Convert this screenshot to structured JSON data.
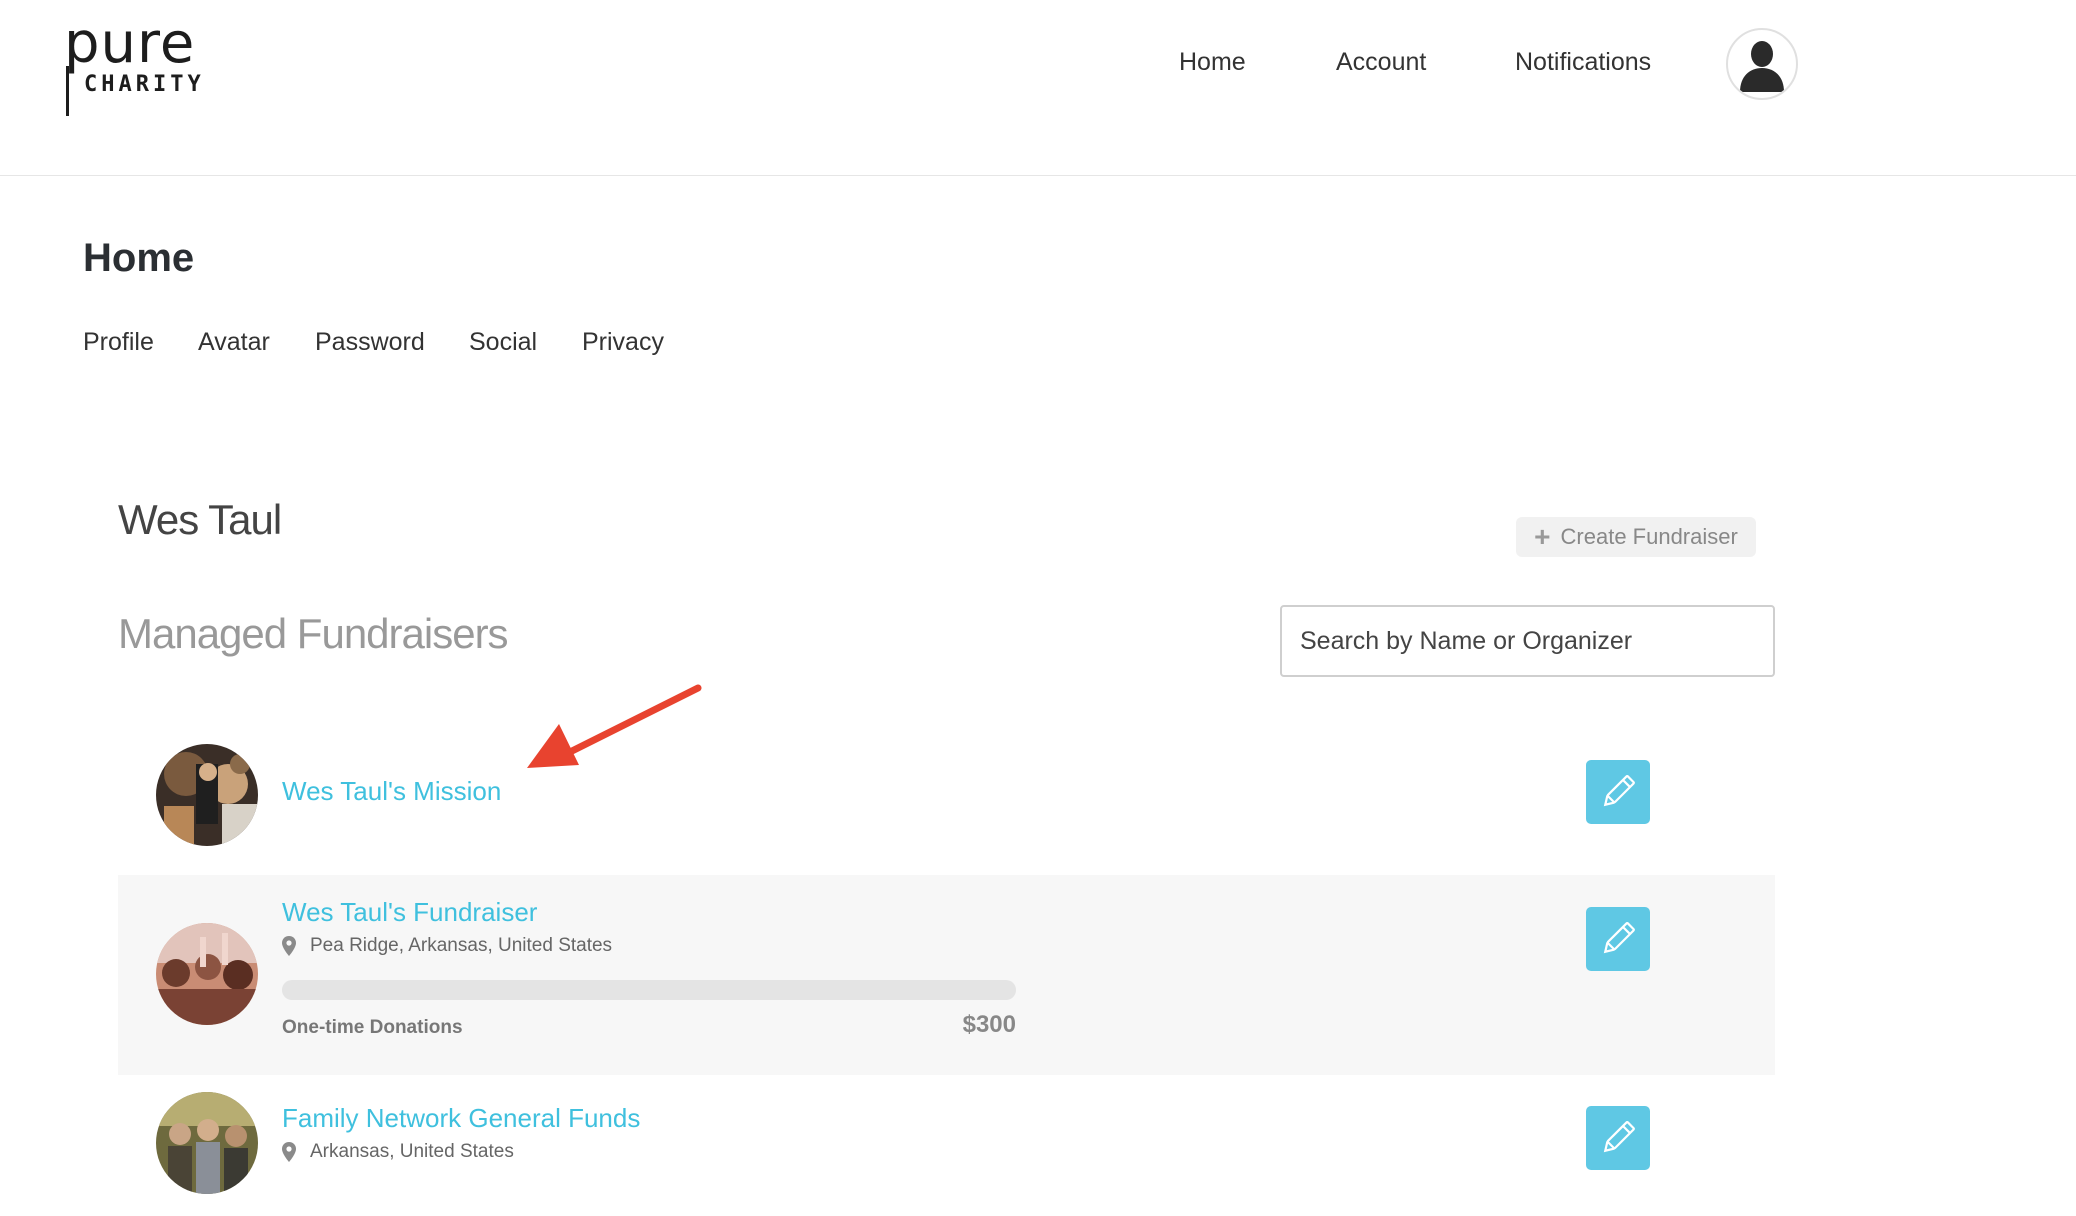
{
  "header": {
    "logo_top": "pure",
    "logo_bottom": "CHARITY",
    "nav": {
      "home": "Home",
      "account": "Account",
      "notifications": "Notifications"
    },
    "user_icon": "user-silhouette-icon"
  },
  "page": {
    "title": "Home",
    "subnav": {
      "profile": "Profile",
      "avatar": "Avatar",
      "password": "Password",
      "social": "Social",
      "privacy": "Privacy"
    }
  },
  "content": {
    "user_name": "Wes Taul",
    "create_button": {
      "icon": "plus-icon",
      "label": "Create Fundraiser"
    },
    "section_title": "Managed Fundraisers",
    "search": {
      "placeholder": "Search by Name or Organizer",
      "value": ""
    },
    "fundraisers": [
      {
        "title": "Wes Taul's Mission"
      },
      {
        "title": "Wes Taul's Fundraiser",
        "location": "Pea Ridge, Arkansas, United States",
        "progress_fraction": 0,
        "donation_label": "One-time Donations",
        "donation_amount": "$300"
      },
      {
        "title": "Family Network General Funds",
        "location": "Arkansas, United States"
      }
    ]
  },
  "colors": {
    "link": "#3fc0de",
    "edit_button": "#5fc8e4",
    "annotation_arrow": "#e8432f"
  }
}
